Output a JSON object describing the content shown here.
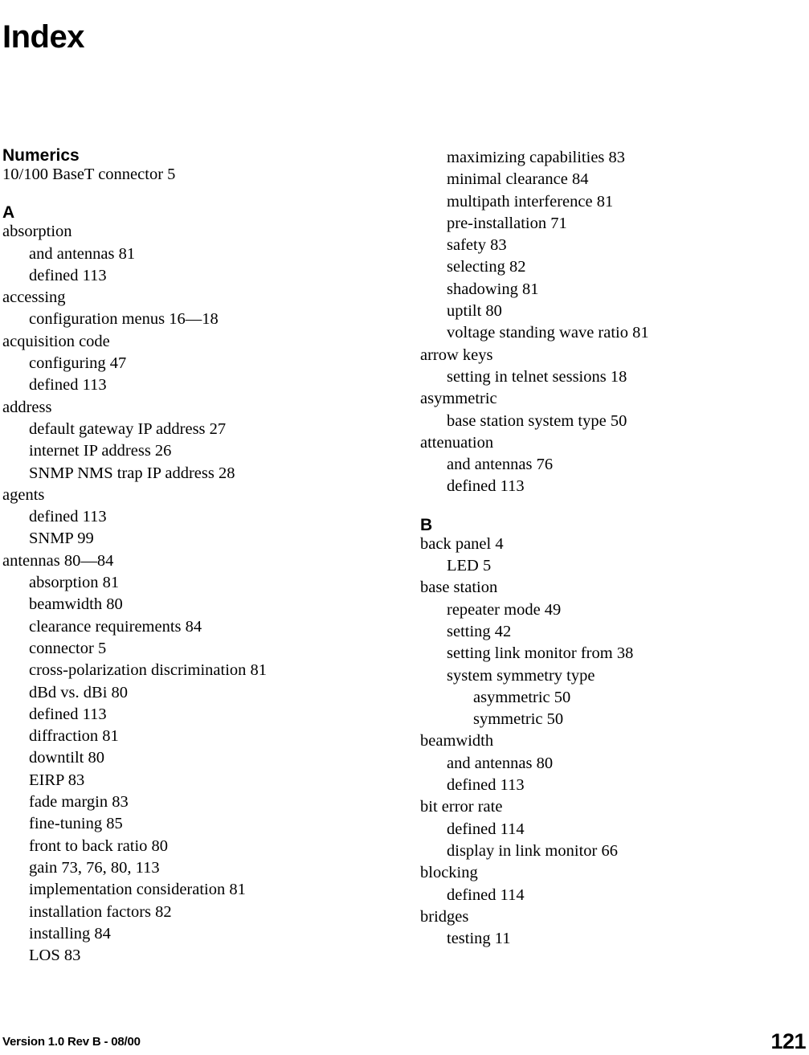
{
  "document": {
    "title": "Index"
  },
  "footer": {
    "version": "Version 1.0 Rev B - 08/00",
    "page_number": "121"
  },
  "columns": {
    "left": {
      "blocks": [
        {
          "kind": "heading",
          "text": "Numerics"
        },
        {
          "kind": "entry",
          "level": 1,
          "text": "10/100 BaseT connector 5"
        },
        {
          "kind": "heading",
          "text": "A"
        },
        {
          "kind": "entry",
          "level": 1,
          "text": "absorption"
        },
        {
          "kind": "entry",
          "level": 2,
          "text": "and antennas 81"
        },
        {
          "kind": "entry",
          "level": 2,
          "text": "defined 113"
        },
        {
          "kind": "entry",
          "level": 1,
          "text": "accessing"
        },
        {
          "kind": "entry",
          "level": 2,
          "text": "configuration menus 16—18"
        },
        {
          "kind": "entry",
          "level": 1,
          "text": "acquisition code"
        },
        {
          "kind": "entry",
          "level": 2,
          "text": "configuring 47"
        },
        {
          "kind": "entry",
          "level": 2,
          "text": "defined 113"
        },
        {
          "kind": "entry",
          "level": 1,
          "text": "address"
        },
        {
          "kind": "entry",
          "level": 2,
          "text": "default gateway IP address 27"
        },
        {
          "kind": "entry",
          "level": 2,
          "text": "internet IP address 26"
        },
        {
          "kind": "entry",
          "level": 2,
          "text": "SNMP NMS trap IP address 28"
        },
        {
          "kind": "entry",
          "level": 1,
          "text": "agents"
        },
        {
          "kind": "entry",
          "level": 2,
          "text": "defined 113"
        },
        {
          "kind": "entry",
          "level": 2,
          "text": "SNMP 99"
        },
        {
          "kind": "entry",
          "level": 1,
          "text": "antennas 80—84"
        },
        {
          "kind": "entry",
          "level": 2,
          "text": "absorption 81"
        },
        {
          "kind": "entry",
          "level": 2,
          "text": "beamwidth 80"
        },
        {
          "kind": "entry",
          "level": 2,
          "text": "clearance requirements 84"
        },
        {
          "kind": "entry",
          "level": 2,
          "text": "connector 5"
        },
        {
          "kind": "entry",
          "level": 2,
          "text": "cross-polarization discrimination 81"
        },
        {
          "kind": "entry",
          "level": 2,
          "text": "dBd vs. dBi 80"
        },
        {
          "kind": "entry",
          "level": 2,
          "text": "defined 113"
        },
        {
          "kind": "entry",
          "level": 2,
          "text": "diffraction 81"
        },
        {
          "kind": "entry",
          "level": 2,
          "text": "downtilt 80"
        },
        {
          "kind": "entry",
          "level": 2,
          "text": "EIRP 83"
        },
        {
          "kind": "entry",
          "level": 2,
          "text": "fade margin 83"
        },
        {
          "kind": "entry",
          "level": 2,
          "text": "fine-tuning 85"
        },
        {
          "kind": "entry",
          "level": 2,
          "text": "front to back ratio 80"
        },
        {
          "kind": "entry",
          "level": 2,
          "text": "gain 73, 76, 80, 113"
        },
        {
          "kind": "entry",
          "level": 2,
          "text": "implementation consideration 81"
        },
        {
          "kind": "entry",
          "level": 2,
          "text": "installation factors 82"
        },
        {
          "kind": "entry",
          "level": 2,
          "text": "installing 84"
        },
        {
          "kind": "entry",
          "level": 2,
          "text": "LOS 83"
        }
      ]
    },
    "right": {
      "blocks": [
        {
          "kind": "entry",
          "level": 2,
          "text": "maximizing capabilities 83"
        },
        {
          "kind": "entry",
          "level": 2,
          "text": "minimal clearance 84"
        },
        {
          "kind": "entry",
          "level": 2,
          "text": "multipath interference 81"
        },
        {
          "kind": "entry",
          "level": 2,
          "text": "pre-installation 71"
        },
        {
          "kind": "entry",
          "level": 2,
          "text": "safety 83"
        },
        {
          "kind": "entry",
          "level": 2,
          "text": "selecting 82"
        },
        {
          "kind": "entry",
          "level": 2,
          "text": "shadowing 81"
        },
        {
          "kind": "entry",
          "level": 2,
          "text": "uptilt 80"
        },
        {
          "kind": "entry",
          "level": 2,
          "text": "voltage standing wave ratio 81"
        },
        {
          "kind": "entry",
          "level": 1,
          "text": "arrow keys"
        },
        {
          "kind": "entry",
          "level": 2,
          "text": "setting in telnet sessions 18"
        },
        {
          "kind": "entry",
          "level": 1,
          "text": "asymmetric"
        },
        {
          "kind": "entry",
          "level": 2,
          "text": "base station system type 50"
        },
        {
          "kind": "entry",
          "level": 1,
          "text": "attenuation"
        },
        {
          "kind": "entry",
          "level": 2,
          "text": "and antennas 76"
        },
        {
          "kind": "entry",
          "level": 2,
          "text": "defined 113"
        },
        {
          "kind": "heading",
          "text": "B"
        },
        {
          "kind": "entry",
          "level": 1,
          "text": "back panel 4"
        },
        {
          "kind": "entry",
          "level": 2,
          "text": "LED 5"
        },
        {
          "kind": "entry",
          "level": 1,
          "text": "base station"
        },
        {
          "kind": "entry",
          "level": 2,
          "text": "repeater mode 49"
        },
        {
          "kind": "entry",
          "level": 2,
          "text": "setting 42"
        },
        {
          "kind": "entry",
          "level": 2,
          "text": "setting link monitor from 38"
        },
        {
          "kind": "entry",
          "level": 2,
          "text": "system symmetry type"
        },
        {
          "kind": "entry",
          "level": 3,
          "text": "asymmetric 50"
        },
        {
          "kind": "entry",
          "level": 3,
          "text": "symmetric 50"
        },
        {
          "kind": "entry",
          "level": 1,
          "text": "beamwidth"
        },
        {
          "kind": "entry",
          "level": 2,
          "text": "and antennas 80"
        },
        {
          "kind": "entry",
          "level": 2,
          "text": "defined 113"
        },
        {
          "kind": "entry",
          "level": 1,
          "text": "bit error rate"
        },
        {
          "kind": "entry",
          "level": 2,
          "text": "defined 114"
        },
        {
          "kind": "entry",
          "level": 2,
          "text": "display in link monitor 66"
        },
        {
          "kind": "entry",
          "level": 1,
          "text": "blocking"
        },
        {
          "kind": "entry",
          "level": 2,
          "text": "defined 114"
        },
        {
          "kind": "entry",
          "level": 1,
          "text": "bridges"
        },
        {
          "kind": "entry",
          "level": 2,
          "text": "testing 11"
        }
      ]
    }
  }
}
